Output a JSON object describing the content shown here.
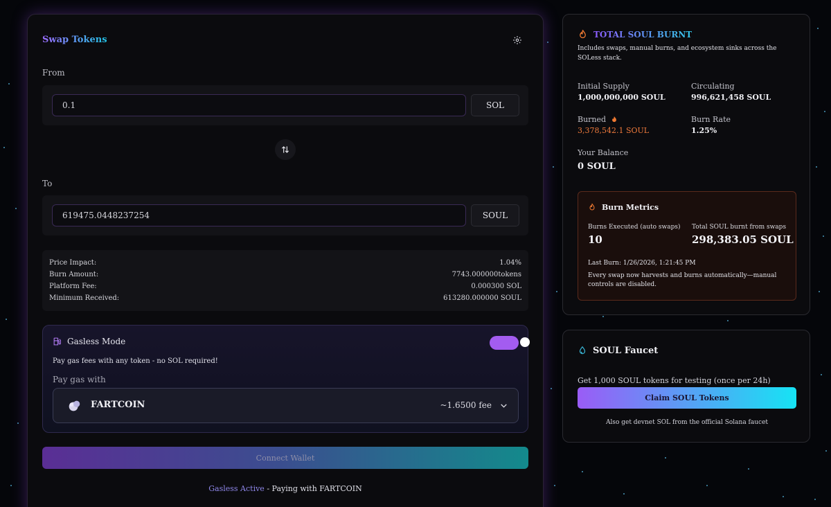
{
  "swap": {
    "title": "Swap Tokens",
    "from_label": "From",
    "from_amount": "0.1",
    "from_token": "SOL",
    "to_label": "To",
    "to_amount": "619475.0448237254",
    "to_token": "SOUL",
    "details": [
      {
        "label": "Price Impact:",
        "value": "1.04%"
      },
      {
        "label": "Burn Amount:",
        "value": "7743.000000tokens"
      },
      {
        "label": "Platform Fee:",
        "value": "0.000300 SOL"
      },
      {
        "label": "Minimum Received:",
        "value": "613280.000000 SOUL"
      }
    ],
    "gasless": {
      "title": "Gasless Mode",
      "enabled": true,
      "subtitle": "Pay gas fees with any token - no SOL required!",
      "pay_with_label": "Pay gas with",
      "token": "FARTCOIN",
      "fee": "~1.6500 fee"
    },
    "connect_label": "Connect Wallet",
    "status_active": "Gasless Active",
    "status_rest": " - Paying with FARTCOIN"
  },
  "burn": {
    "title": "TOTAL SOUL BURNT",
    "description": "Includes swaps, manual burns, and ecosystem sinks across the SOLess stack.",
    "initial_supply_label": "Initial Supply",
    "initial_supply": "1,000,000,000 SOUL",
    "circulating_label": "Circulating",
    "circulating": "996,621,458 SOUL",
    "burned_label": "Burned",
    "burned": "3,378,542.1 SOUL",
    "burn_rate_label": "Burn Rate",
    "burn_rate": "1.25%",
    "balance_label": "Your Balance",
    "balance": "0 SOUL",
    "metrics": {
      "title": "Burn Metrics",
      "executed_label": "Burns Executed (auto swaps)",
      "executed": "10",
      "total_label": "Total SOUL burnt from swaps",
      "total": "298,383.05 SOUL",
      "last_burn": "Last Burn: 1/26/2026, 1:21:45 PM",
      "note": "Every swap now harvests and burns automatically—manual controls are disabled."
    }
  },
  "faucet": {
    "title": "SOUL Faucet",
    "description": "Get 1,000 SOUL tokens for testing (once per 24h)",
    "button": "Claim SOUL Tokens",
    "note": "Also get devnet SOL from the official Solana faucet"
  },
  "colors": {
    "background": "#05060a",
    "accent_purple": "#9a5cf6",
    "accent_cyan": "#16e3f4",
    "burn_orange": "#ef7a3c"
  },
  "icons": {
    "settings": "gear-icon",
    "swap_direction": "swap-arrows-icon",
    "gas": "fuel-pump-icon",
    "fire": "flame-icon",
    "faucet": "droplet-icon",
    "dropdown": "chevron-down-icon"
  }
}
